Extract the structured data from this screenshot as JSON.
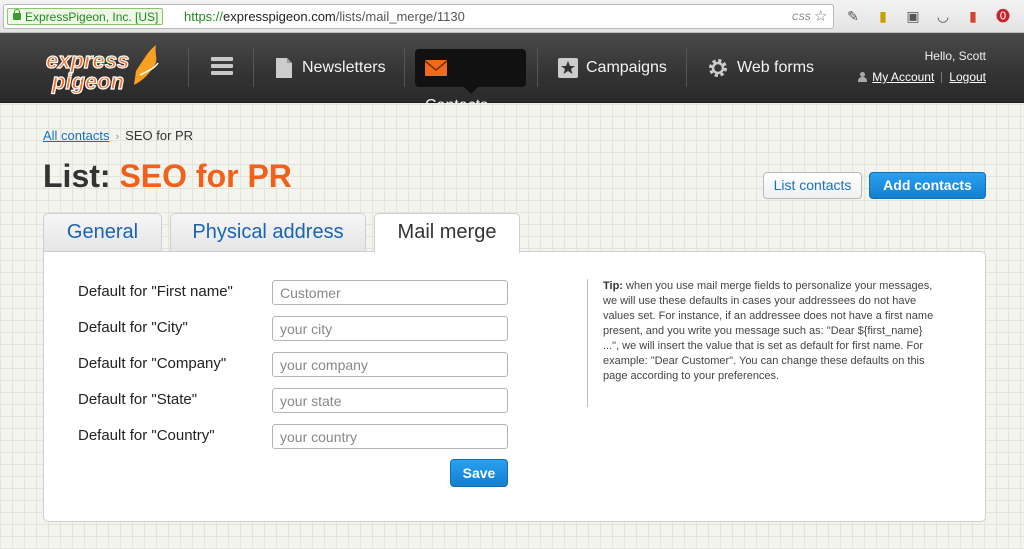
{
  "browser": {
    "ev_label": "ExpressPigeon, Inc. [US]",
    "url_scheme": "https://",
    "url_host": "expresspigeon.com",
    "url_path": "/lists/mail_merge/1130",
    "css_badge": "CSS"
  },
  "header": {
    "logo_line1": "express",
    "logo_line2": "pigeon",
    "nav": [
      {
        "label": "Newsletters",
        "icon": "document-icon"
      },
      {
        "label": "Contacts",
        "icon": "envelope-icon",
        "active": true
      },
      {
        "label": "Campaigns",
        "icon": "star-icon"
      },
      {
        "label": "Web forms",
        "icon": "gear-icon"
      }
    ],
    "greeting": "Hello, Scott",
    "my_account": "My Account",
    "logout": "Logout"
  },
  "breadcrumb": {
    "root": "All contacts",
    "current": "SEO for PR"
  },
  "page": {
    "title_prefix": "List:",
    "title_name": "SEO for PR",
    "list_contacts_button": "List contacts",
    "add_contacts_button": "Add contacts"
  },
  "tabs": [
    {
      "label": "General"
    },
    {
      "label": "Physical address"
    },
    {
      "label": "Mail merge",
      "active": true
    }
  ],
  "form": {
    "fields": [
      {
        "label": "Default for \"First name\"",
        "value": "",
        "placeholder": "Customer"
      },
      {
        "label": "Default for \"City\"",
        "value": "",
        "placeholder": "your city"
      },
      {
        "label": "Default for \"Company\"",
        "value": "",
        "placeholder": "your company"
      },
      {
        "label": "Default for \"State\"",
        "value": "",
        "placeholder": "your state"
      },
      {
        "label": "Default for \"Country\"",
        "value": "",
        "placeholder": "your country"
      }
    ],
    "save_label": "Save"
  },
  "tip": {
    "heading": "Tip:",
    "text": "when you use mail merge fields to personalize your messages, we will use these defaults in cases your addressees do not have values set. For instance, if an addressee does not have a first name present, and you write you message such as: \"Dear ${first_name} ...\", we will insert the value that is set as default for first name. For example: \"Dear Customer\". You can change these defaults on this page according to your preferences."
  },
  "colors": {
    "brand_orange": "#f0611b",
    "link_blue": "#1670c4",
    "primary_button": "#1f8fe0"
  }
}
